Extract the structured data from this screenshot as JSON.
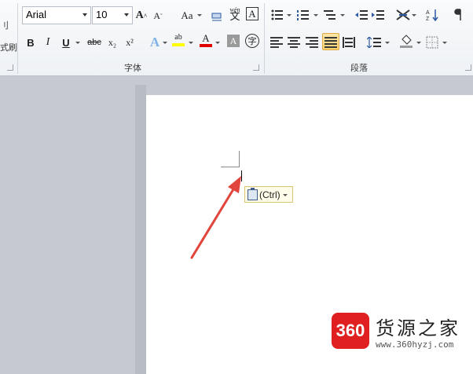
{
  "ribbon": {
    "left_cut_top": "刂",
    "left_cut_bottom": "式刷",
    "font_name": "Arial",
    "font_size": "10",
    "group_font_label": "字体",
    "group_paragraph_label": "段落",
    "btn_grow": "A",
    "btn_shrink": "A",
    "btn_case": "Aa",
    "btn_bold": "B",
    "btn_italic": "I",
    "btn_underline": "U",
    "btn_strike": "abc",
    "btn_sub": "x₂",
    "btn_sup": "x²",
    "btn_text_effect": "A",
    "btn_highlight": "ab",
    "btn_font_color": "A",
    "btn_char_shade": "A",
    "btn_enclose": "字",
    "btn_phonetic": "wén",
    "btn_phonetic_char": "文",
    "btn_border_char": "A"
  },
  "document": {
    "paste_options_label": "(Ctrl)"
  },
  "watermark": {
    "logo_text": "360",
    "title": "货源之家",
    "url": "www.360hyzj.com"
  },
  "colors": {
    "highlight": "#ffff00",
    "font_color": "#e00000",
    "arrow": "#e2453c"
  }
}
